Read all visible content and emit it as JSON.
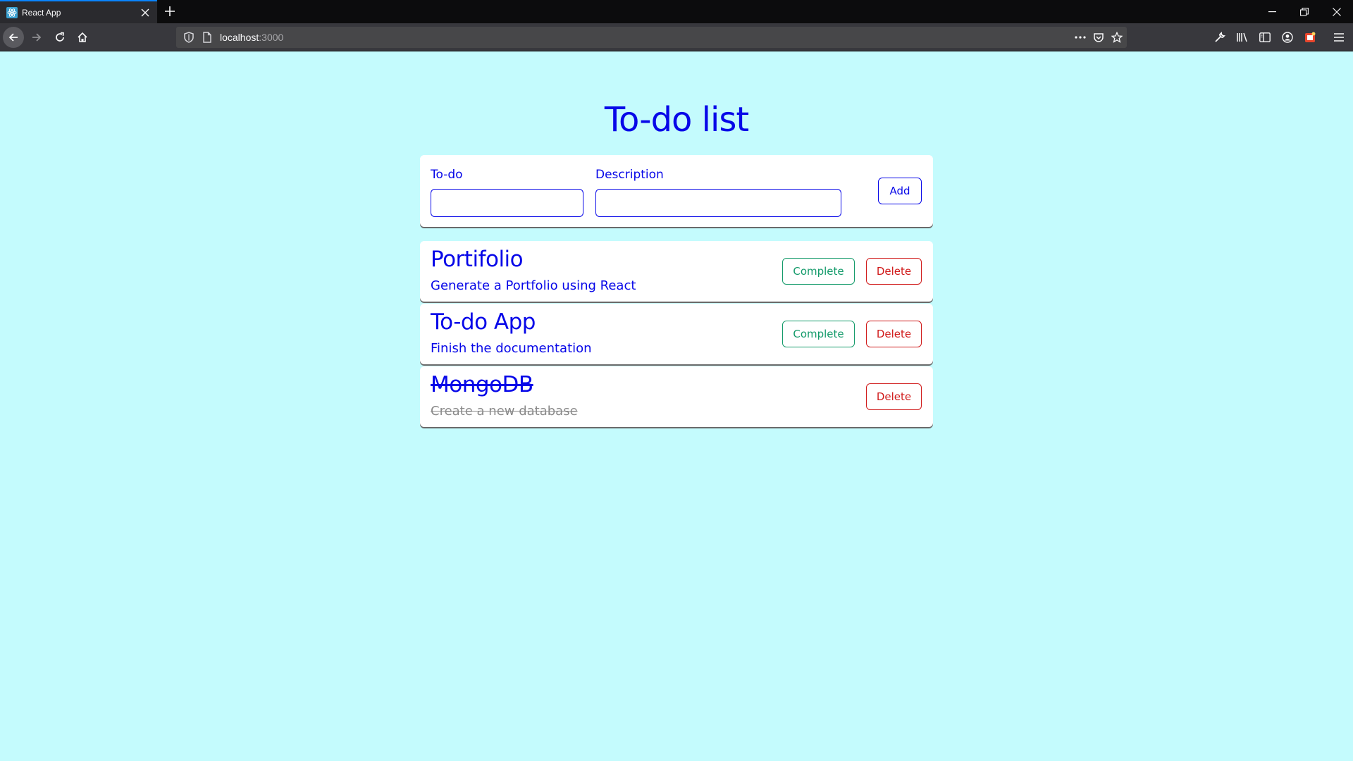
{
  "browser": {
    "tab_title": "React App",
    "url_host": "localhost",
    "url_port": ":3000",
    "icons": {
      "favicon": "react-icon",
      "tab_close": "close-icon",
      "new_tab": "plus-icon",
      "minimize": "minimize-icon",
      "restore": "restore-icon",
      "close_window": "close-icon",
      "back": "arrow-left-icon",
      "forward": "arrow-right-icon",
      "reload": "reload-icon",
      "home": "home-icon",
      "tracking": "shield-icon",
      "page_info": "page-icon",
      "page_actions": "ellipsis-icon",
      "pocket": "pocket-icon",
      "bookmark": "star-icon",
      "tools": "wrench-icon",
      "library": "library-icon",
      "sidebar": "sidebar-icon",
      "account": "account-icon",
      "extension": "extension-icon",
      "menu": "hamburger-icon"
    },
    "colors": {
      "tab_strip": "#0c0c0d",
      "active_tab": "#2a2a2e",
      "toolbar": "#38383d",
      "urlbar": "#474749",
      "accent": "#0a84ff"
    }
  },
  "app": {
    "title": "To-do list",
    "form": {
      "todo_label": "To-do",
      "todo_value": "",
      "description_label": "Description",
      "description_value": "",
      "add_label": "Add"
    },
    "todos": [
      {
        "title": "Portifolio",
        "description": "Generate a Portfolio using React",
        "completed": false,
        "complete_label": "Complete",
        "delete_label": "Delete"
      },
      {
        "title": "To-do App",
        "description": "Finish the documentation",
        "completed": false,
        "complete_label": "Complete",
        "delete_label": "Delete"
      },
      {
        "title": "MongoDB",
        "description": "Create a new database",
        "completed": true,
        "delete_label": "Delete"
      }
    ],
    "colors": {
      "background": "#c4fbfd",
      "primary": "#0707e8",
      "complete": "#159b6b",
      "delete": "#d01a1a",
      "done_text": "#8a8a8a"
    }
  }
}
